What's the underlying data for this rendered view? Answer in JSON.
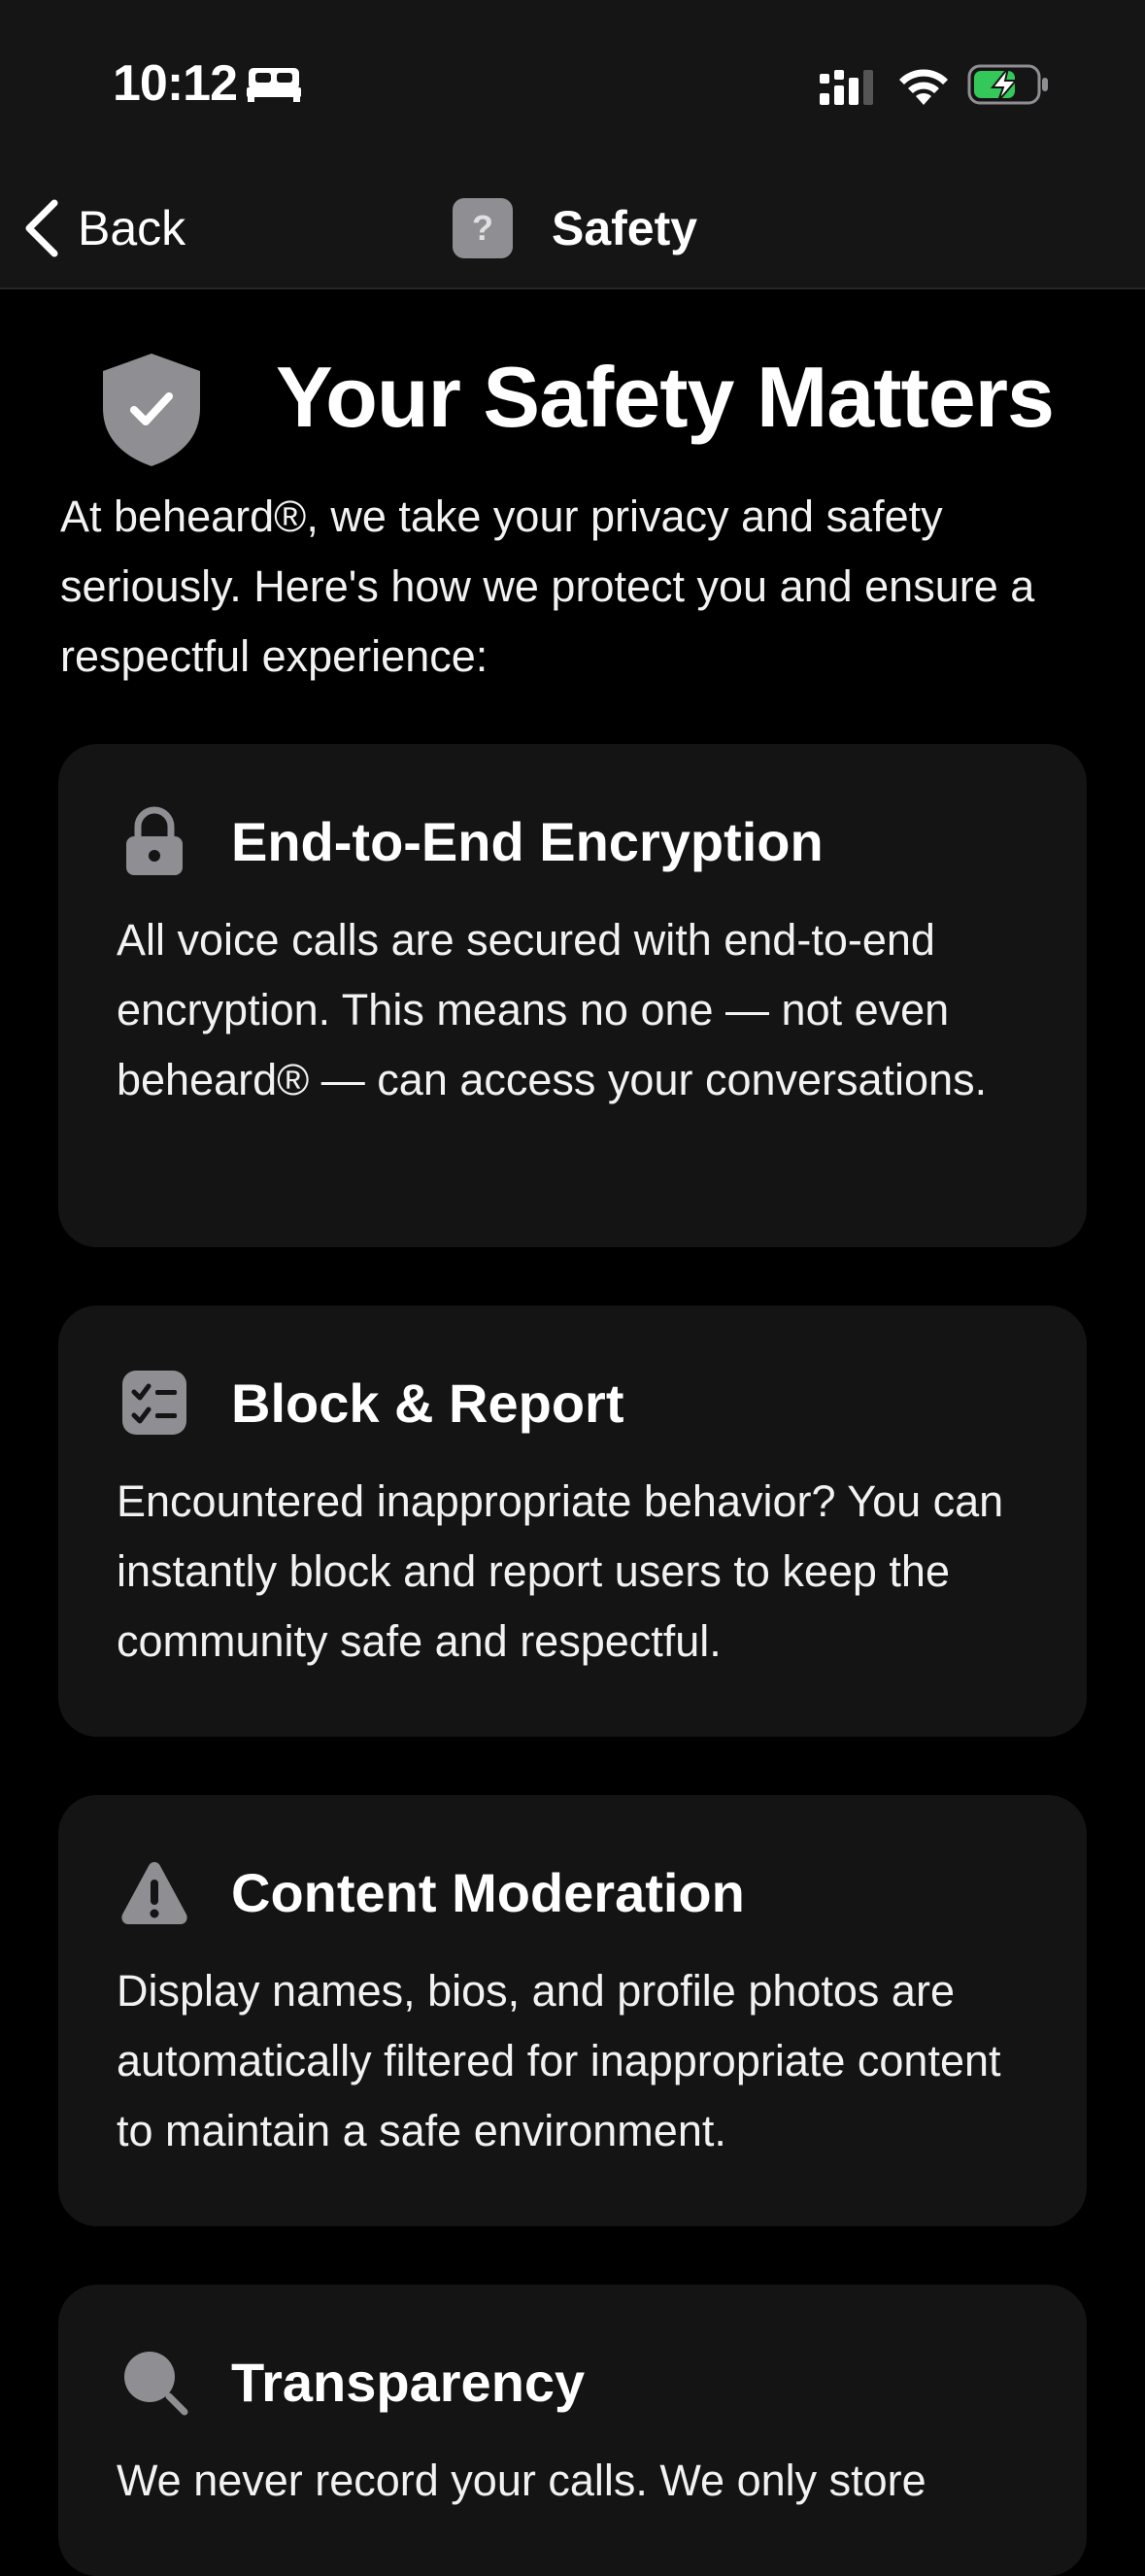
{
  "status_bar": {
    "time": "10:12"
  },
  "nav": {
    "back_label": "Back",
    "title": "Safety",
    "help_glyph": "?"
  },
  "hero": {
    "title": "Your Safety Matters",
    "intro": "At beheard®, we take your privacy and safety seriously. Here's how we protect you and ensure a respectful experience:"
  },
  "cards": [
    {
      "icon": "lock-icon",
      "title": "End-to-End Encryption",
      "text": "All voice calls are secured with end-to-end encryption. This means no one — not even beheard® — can access your conversations."
    },
    {
      "icon": "checklist-icon",
      "title": "Block & Report",
      "text": "Encountered inappropriate behavior? You can instantly block and report users to keep the community safe and respectful."
    },
    {
      "icon": "warning-icon",
      "title": "Content Moderation",
      "text": "Display names, bios, and profile photos are automatically filtered for inappropriate content to maintain a safe environment."
    },
    {
      "icon": "magnifier-icon",
      "title": "Transparency",
      "text": "We never record your calls. We only store"
    }
  ],
  "colors": {
    "background": "#000000",
    "bar_background": "#151515",
    "card_background": "#141414",
    "icon_gray": "#8e8e93",
    "battery_green": "#34c759"
  }
}
